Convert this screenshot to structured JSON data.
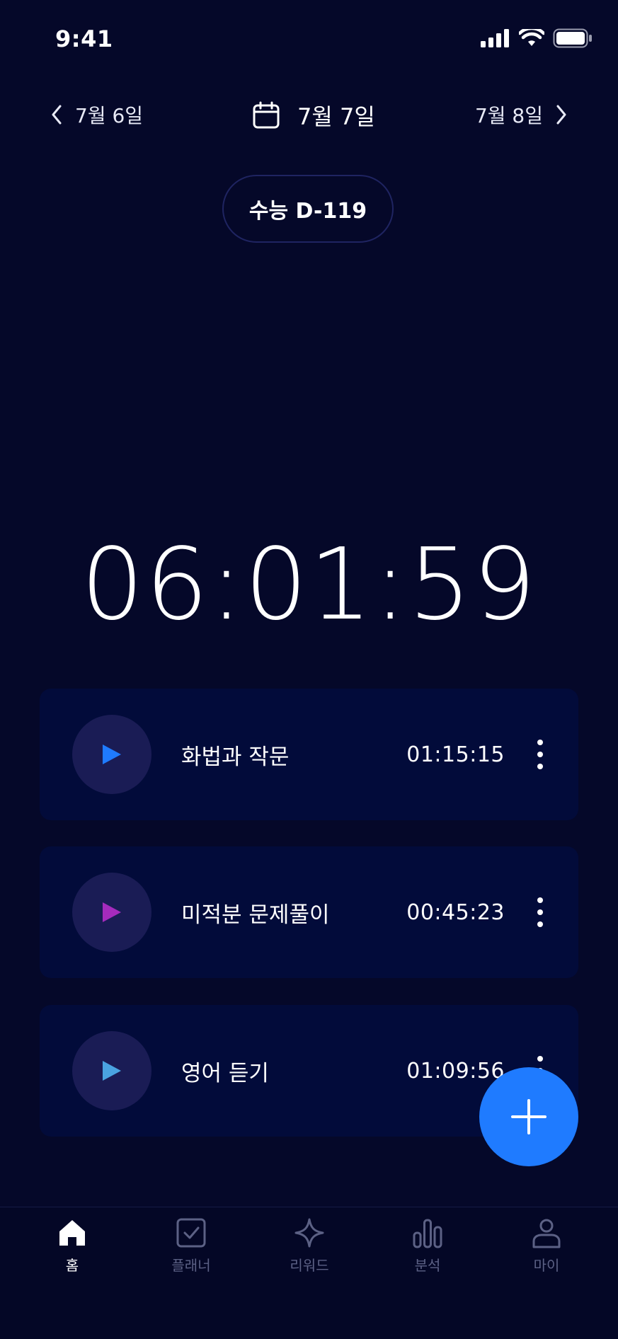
{
  "status": {
    "time": "9:41"
  },
  "date_nav": {
    "prev_label": "7월 6일",
    "current_label": "7월 7일",
    "next_label": "7월 8일"
  },
  "dday": {
    "label": "수능 D-119"
  },
  "timer": {
    "value": "06:01:59"
  },
  "subjects": [
    {
      "title": "화법과 작문",
      "time": "01:15:15",
      "color": "#1f7bff"
    },
    {
      "title": "미적분 문제풀이",
      "time": "00:45:23",
      "color": "#a52bbd"
    },
    {
      "title": "영어 듣기",
      "time": "01:09:56",
      "color": "#4aa3e0"
    }
  ],
  "tabs": [
    {
      "label": "홈",
      "icon": "home-icon",
      "active": true
    },
    {
      "label": "플래너",
      "icon": "checkbox-icon",
      "active": false
    },
    {
      "label": "리워드",
      "icon": "sparkle-icon",
      "active": false
    },
    {
      "label": "분석",
      "icon": "bar-chart-icon",
      "active": false
    },
    {
      "label": "마이",
      "icon": "person-icon",
      "active": false
    }
  ],
  "colors": {
    "background": "#050829",
    "card": "#020b3a",
    "accent": "#1f7bff",
    "tab_inactive": "#5c6185"
  }
}
